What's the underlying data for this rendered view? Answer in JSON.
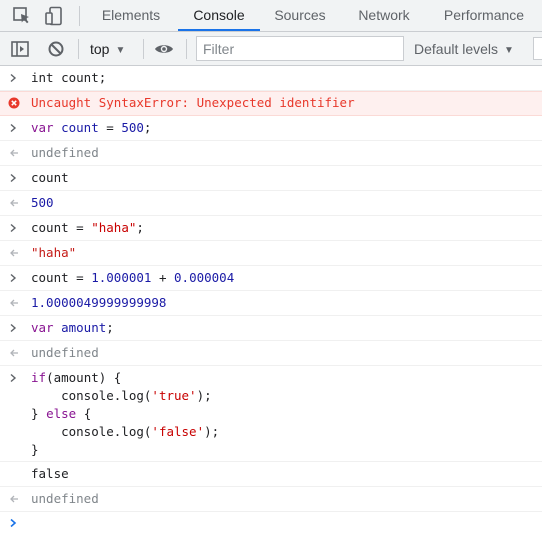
{
  "devtools": {
    "tabs": [
      {
        "label": "Elements"
      },
      {
        "label": "Console",
        "active": true
      },
      {
        "label": "Sources"
      },
      {
        "label": "Network"
      },
      {
        "label": "Performance"
      }
    ]
  },
  "toolbar": {
    "context": "top",
    "filter_placeholder": "Filter",
    "filter_value": "",
    "levels": "Default levels",
    "levels_caret": "▼"
  },
  "console": {
    "entries": [
      {
        "kind": "input",
        "tokens": [
          {
            "t": "int count;",
            "c": "plain"
          }
        ]
      },
      {
        "kind": "error",
        "text": "Uncaught SyntaxError: Unexpected identifier"
      },
      {
        "kind": "input",
        "tokens": [
          {
            "t": "var",
            "c": "kw"
          },
          {
            "t": " ",
            "c": "plain"
          },
          {
            "t": "count",
            "c": "var"
          },
          {
            "t": " = ",
            "c": "op"
          },
          {
            "t": "500",
            "c": "num"
          },
          {
            "t": ";",
            "c": "op"
          }
        ]
      },
      {
        "kind": "result",
        "text": "undefined",
        "c": "undef"
      },
      {
        "kind": "input",
        "tokens": [
          {
            "t": "count",
            "c": "plain"
          }
        ]
      },
      {
        "kind": "result",
        "text": "500",
        "c": "numres"
      },
      {
        "kind": "input",
        "tokens": [
          {
            "t": "count",
            "c": "plain"
          },
          {
            "t": " = ",
            "c": "op"
          },
          {
            "t": "\"haha\"",
            "c": "str"
          },
          {
            "t": ";",
            "c": "op"
          }
        ]
      },
      {
        "kind": "result",
        "text": "\"haha\"",
        "c": "strres"
      },
      {
        "kind": "input",
        "tokens": [
          {
            "t": "count",
            "c": "plain"
          },
          {
            "t": " = ",
            "c": "op"
          },
          {
            "t": "1.000001",
            "c": "num"
          },
          {
            "t": " + ",
            "c": "op"
          },
          {
            "t": "0.000004",
            "c": "num"
          }
        ]
      },
      {
        "kind": "result",
        "text": "1.0000049999999998",
        "c": "numres"
      },
      {
        "kind": "input",
        "tokens": [
          {
            "t": "var",
            "c": "kw"
          },
          {
            "t": " ",
            "c": "plain"
          },
          {
            "t": "amount",
            "c": "var"
          },
          {
            "t": ";",
            "c": "op"
          }
        ]
      },
      {
        "kind": "result",
        "text": "undefined",
        "c": "undef"
      },
      {
        "kind": "input",
        "multiline": true,
        "lines": [
          [
            {
              "t": "if",
              "c": "kw"
            },
            {
              "t": "(amount) {",
              "c": "plain"
            }
          ],
          [
            {
              "t": "    console.log(",
              "c": "plain"
            },
            {
              "t": "'true'",
              "c": "str"
            },
            {
              "t": ");",
              "c": "plain"
            }
          ],
          [
            {
              "t": "} ",
              "c": "plain"
            },
            {
              "t": "else",
              "c": "kw"
            },
            {
              "t": " {",
              "c": "plain"
            }
          ],
          [
            {
              "t": "    console.log(",
              "c": "plain"
            },
            {
              "t": "'false'",
              "c": "str"
            },
            {
              "t": ");",
              "c": "plain"
            }
          ],
          [
            {
              "t": "}",
              "c": "plain"
            }
          ]
        ]
      },
      {
        "kind": "log",
        "text": "false"
      },
      {
        "kind": "result",
        "text": "undefined",
        "c": "undef"
      }
    ],
    "prompt_caret": "›"
  },
  "colors": {
    "accent": "#1a73e8",
    "error": "#e8382b",
    "keyword": "#881391",
    "number": "#1a1aa6",
    "string": "#c80000",
    "undefined": "#80868b"
  }
}
